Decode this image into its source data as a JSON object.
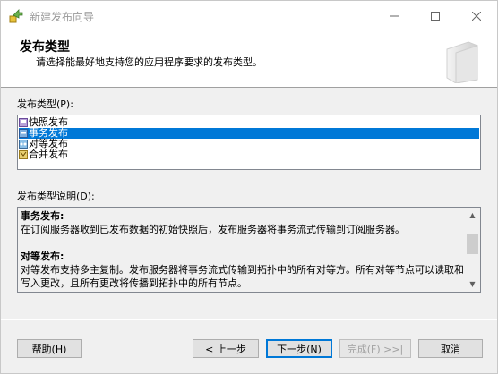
{
  "window": {
    "title": "新建发布向导"
  },
  "header": {
    "title": "发布类型",
    "subtitle": "请选择能最好地支持您的应用程序要求的发布类型。"
  },
  "publication_type": {
    "label": "发布类型(P):",
    "items": [
      {
        "label": "快照发布",
        "icon": "snapshot-publication-icon",
        "selected": false
      },
      {
        "label": "事务发布",
        "icon": "transactional-publication-icon",
        "selected": true
      },
      {
        "label": "对等发布",
        "icon": "peer-to-peer-publication-icon",
        "selected": false
      },
      {
        "label": "合并发布",
        "icon": "merge-publication-icon",
        "selected": false
      }
    ]
  },
  "description": {
    "label": "发布类型说明(D):",
    "section1_title": "事务发布:",
    "section1_body": "在订阅服务器收到已发布数据的初始快照后，发布服务器将事务流式传输到订阅服务器。",
    "section2_title": "对等发布:",
    "section2_body": "对等发布支持多主复制。发布服务器将事务流式传输到拓扑中的所有对等方。所有对等节点可以读取和写入更改，且所有更改将传播到拓扑中的所有节点。"
  },
  "buttons": {
    "help": "帮助(H)",
    "back": "< 上一步",
    "next": "下一步(N)",
    "finish": "完成(F) >>|",
    "cancel": "取消"
  },
  "colors": {
    "selection": "#0078d7",
    "background": "#f0f0f0"
  }
}
